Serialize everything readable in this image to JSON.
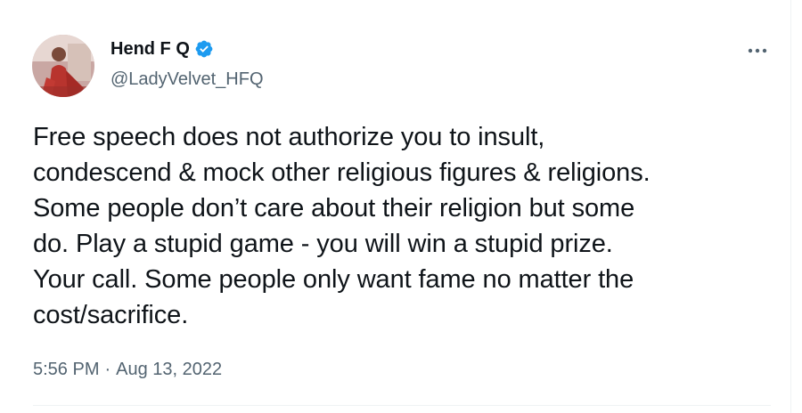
{
  "author": {
    "display_name": "Hend F Q",
    "handle": "@LadyVelvet_HFQ",
    "verified": true,
    "avatar_icon": "profile-photo-avatar"
  },
  "tweet": {
    "text": "Free speech does not authorize you to insult,\ncondescend & mock other religious figures & religions.\nSome people don’t care about their religion but some\ndo. Play a stupid game - you will win a stupid prize.\nYour call. Some people only want fame no matter the\ncost/sacrifice.",
    "time": "5:56 PM",
    "separator": "·",
    "date": "Aug 13, 2022"
  },
  "menu": {
    "more_icon": "more-horizontal-icon"
  },
  "colors": {
    "text_primary": "#0f1419",
    "text_secondary": "#536471",
    "verified_blue": "#1d9bf0",
    "divider": "#eff3f4"
  }
}
